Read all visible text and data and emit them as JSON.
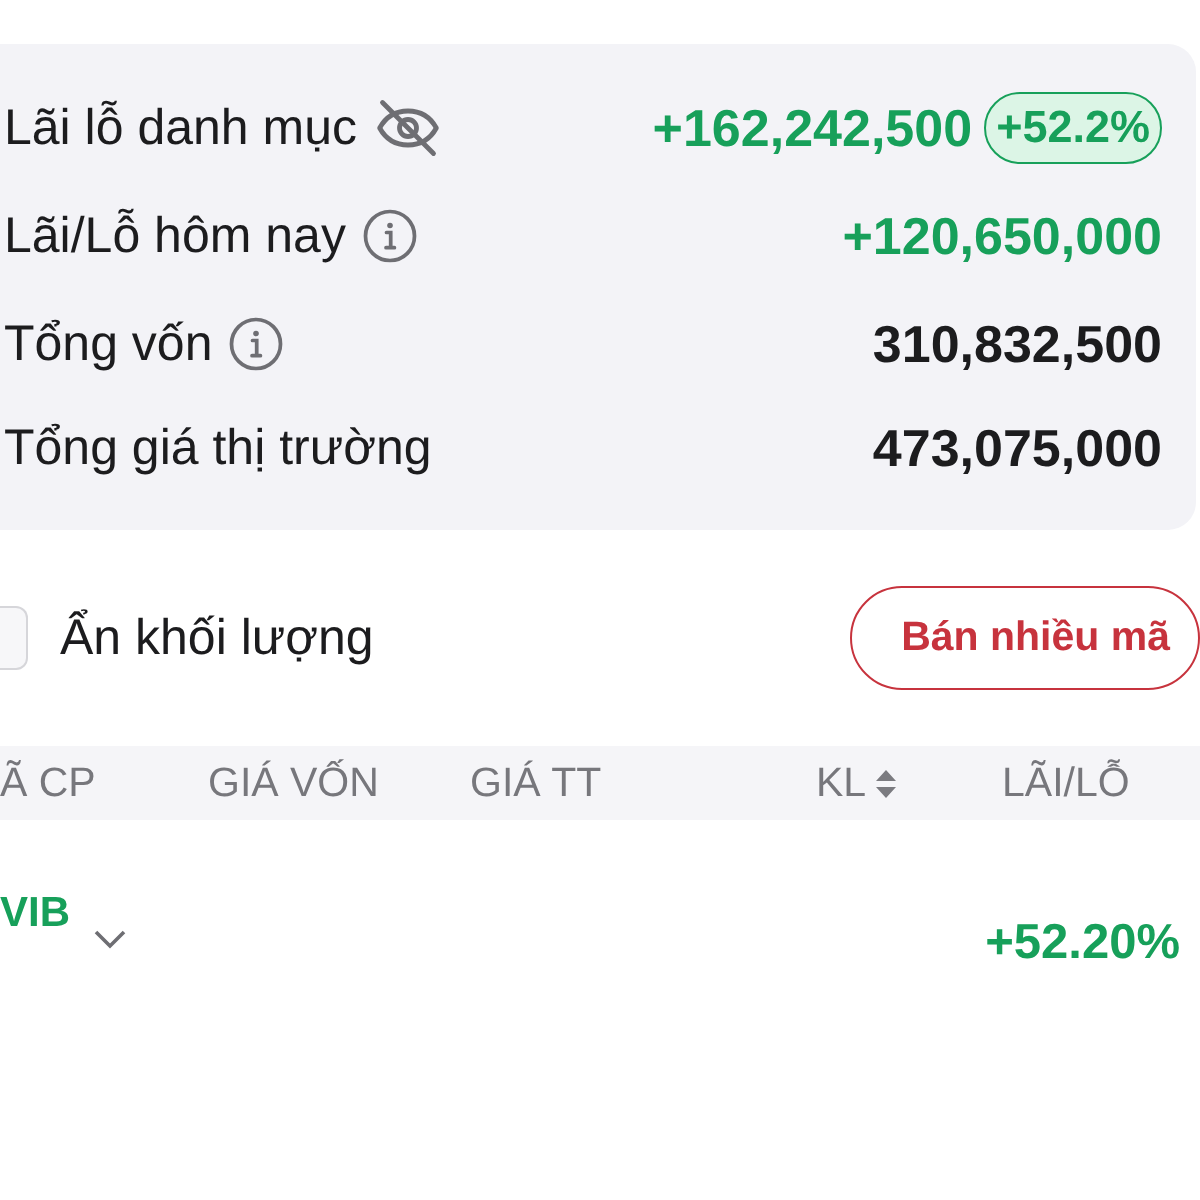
{
  "summary": {
    "rows": [
      {
        "label": "Lãi lỗ danh mục",
        "kind": "privacy",
        "value": "+162,242,500",
        "color": "#17a05a",
        "badge": "+52.2%"
      },
      {
        "label": "Lãi/Lỗ hôm nay",
        "kind": "info",
        "value": "+120,650,000",
        "color": "#17a05a"
      },
      {
        "label": "Tổng vốn",
        "kind": "info",
        "value": "310,832,500",
        "color": "#1c1c1e"
      },
      {
        "label": "Tổng giá thị trường",
        "kind": "plain",
        "value": "473,075,000",
        "color": "#1c1c1e"
      }
    ]
  },
  "controls": {
    "hide_volume": {
      "label": "Ẩn khối lượng",
      "checked": false
    },
    "sell_button": "Bán nhiều mã"
  },
  "table": {
    "columns": [
      {
        "label": "Ã CP",
        "sortable": false
      },
      {
        "label": "GIÁ VỐN",
        "sortable": false
      },
      {
        "label": "GIÁ TT",
        "sortable": false
      },
      {
        "label": "KL",
        "sortable": true
      },
      {
        "label": "LÃI/LỖ",
        "sortable": false
      }
    ],
    "rows": [
      {
        "symbol": "VIB",
        "expanded": false,
        "pnl": "+52.20%",
        "color": "#17a05a"
      }
    ]
  }
}
